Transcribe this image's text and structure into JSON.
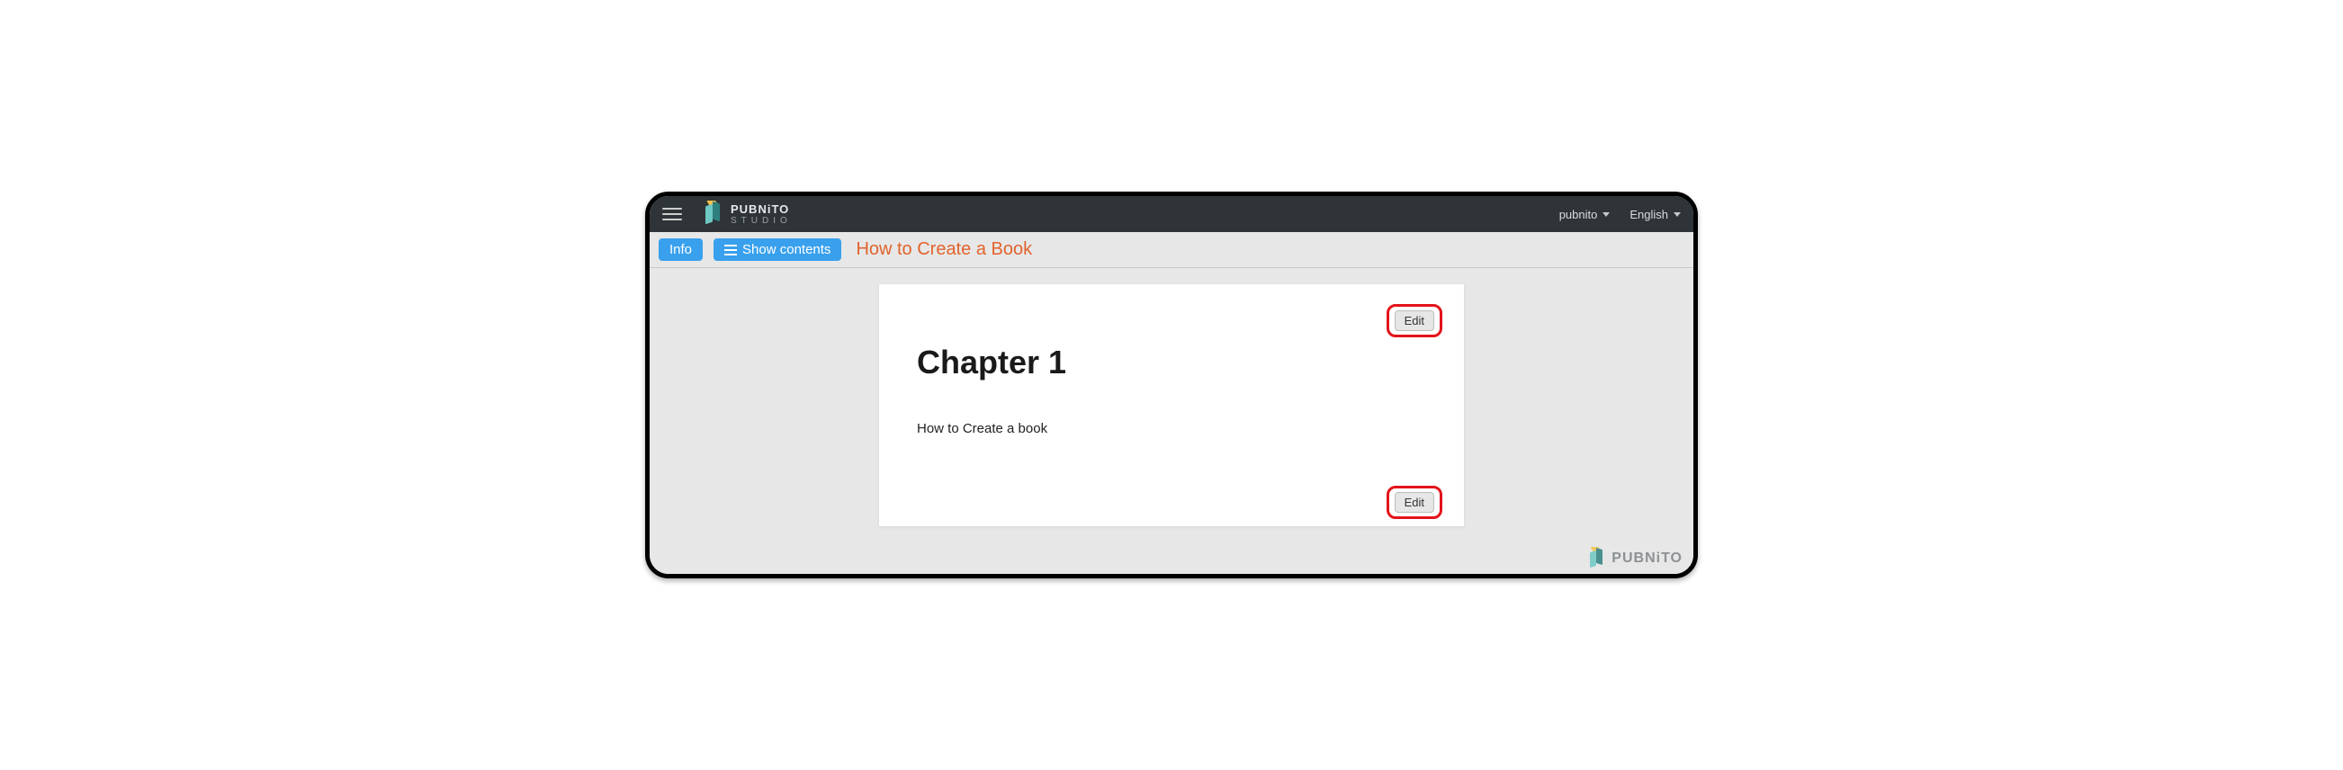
{
  "header": {
    "brand_name": "PUBNiTO",
    "brand_sub": "STUDIO",
    "user_menu": "pubnito",
    "lang_menu": "English"
  },
  "toolbar": {
    "info_label": "Info",
    "show_contents_label": "Show contents",
    "book_title": "How to Create a Book"
  },
  "page": {
    "edit_label_top": "Edit",
    "edit_label_bottom": "Edit",
    "chapter_heading": "Chapter 1",
    "chapter_text": "How to Create a book"
  },
  "watermark": {
    "text": "PUBNiTO"
  }
}
